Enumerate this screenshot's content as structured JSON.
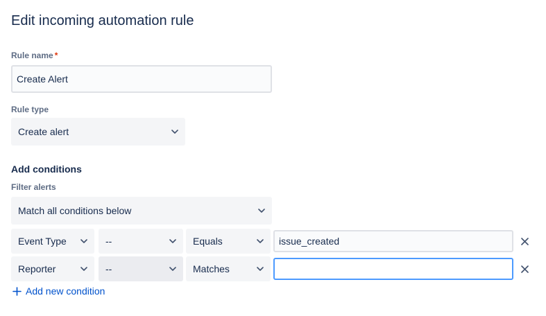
{
  "page": {
    "title": "Edit incoming automation rule"
  },
  "rule_name": {
    "label": "Rule name",
    "required_mark": "*",
    "value": "Create Alert"
  },
  "rule_type": {
    "label": "Rule type",
    "value": "Create alert"
  },
  "conditions": {
    "heading": "Add conditions",
    "filter_label": "Filter alerts",
    "filter_value": "Match all conditions below",
    "rows": [
      {
        "field": "Event Type",
        "modifier": "--",
        "operator": "Equals",
        "value": "issue_created"
      },
      {
        "field": "Reporter",
        "modifier": "--",
        "operator": "Matches",
        "value": ""
      }
    ],
    "add_label": "Add new condition"
  },
  "colors": {
    "accent": "#0052cc",
    "focus": "#4c9aff",
    "required": "#de350b",
    "field_bg": "#f4f5f7"
  },
  "icons": {
    "dropdown": "chevron-down-icon",
    "remove": "close-icon",
    "add": "plus-icon"
  }
}
